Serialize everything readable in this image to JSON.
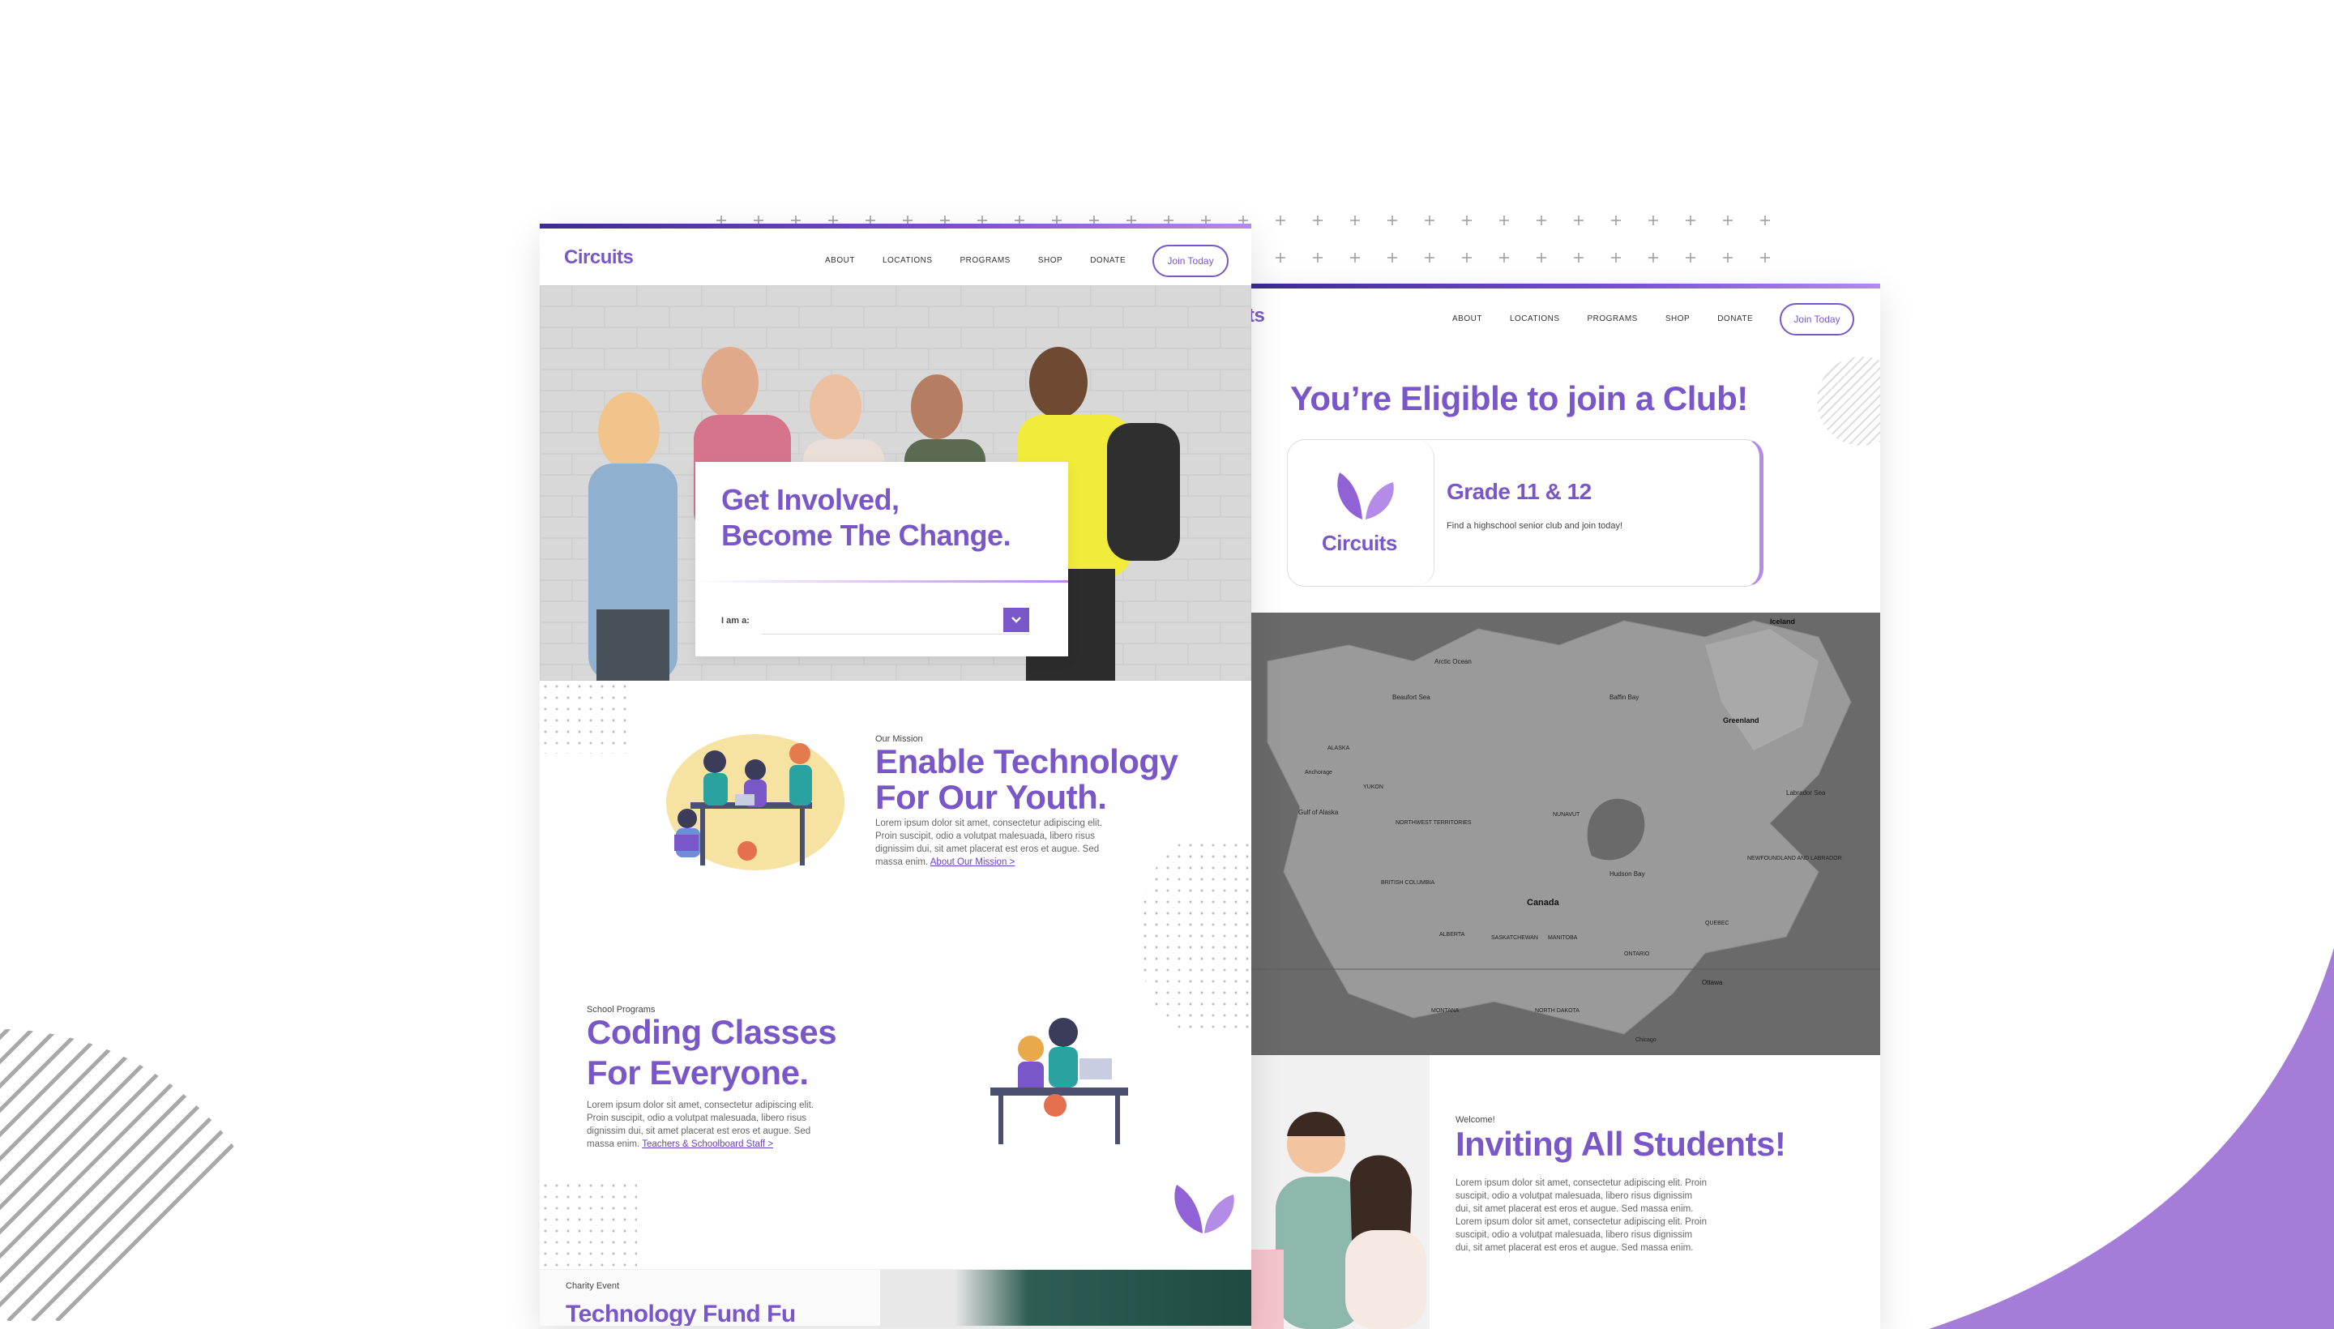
{
  "left_page": {
    "logo": "Circuits",
    "nav": [
      "ABOUT",
      "LOCATIONS",
      "PROGRAMS",
      "SHOP",
      "DONATE"
    ],
    "join_button": "Join Today",
    "hero": {
      "line1": "Get Involved,",
      "line2": "Become The Change.",
      "select_label": "I am a:",
      "select_value": ""
    },
    "mission": {
      "eyebrow": "Our Mission",
      "title_line1": "Enable Technology",
      "title_line2": "For Our Youth.",
      "body": "Lorem ipsum dolor sit amet, consectetur adipiscing elit. Proin suscipit, odio a volutpat malesuada, libero risus dignissim dui, sit amet placerat est eros et augue. Sed massa enim.",
      "link": "About Our Mission >"
    },
    "programs": {
      "eyebrow": "School Programs",
      "title_line1": "Coding Classes",
      "title_line2": "For Everyone.",
      "body": "Lorem ipsum dolor sit amet, consectetur adipiscing elit. Proin suscipit, odio a volutpat malesuada, libero risus dignissim dui, sit amet placerat est eros et augue. Sed massa enim.",
      "link": "Teachers & Schoolboard Staff >"
    },
    "charity": {
      "eyebrow": "Charity Event",
      "title": "Technology Fund Fu"
    }
  },
  "right_page": {
    "logo_fragment": "ts",
    "nav": [
      "ABOUT",
      "LOCATIONS",
      "PROGRAMS",
      "SHOP",
      "DONATE"
    ],
    "join_button": "Join Today",
    "eligible_title": "You’re Eligible to join a Club!",
    "card": {
      "logo": "Circuits",
      "title": "Grade 11 & 12",
      "text": "Find a highschool senior club and join today!"
    },
    "map": {
      "labels": {
        "canada": "Canada",
        "greenland": "Greenland",
        "iceland": "Iceland",
        "hudson_bay": "Hudson Bay",
        "baffin_bay": "Baffin Bay",
        "beaufort_sea": "Beaufort Sea",
        "alaska": "ALASKA",
        "anchorage": "Anchorage",
        "gulf_of_alaska": "Gulf of Alaska",
        "arctic_ocean": "Arctic Ocean",
        "labrador_sea": "Labrador Sea",
        "ottawa": "Ottawa",
        "northwest_territories": "NORTHWEST TERRITORIES",
        "nunavut": "NUNAVUT",
        "manitoba": "MANITOBA",
        "quebec": "QUEBEC",
        "ontario": "ONTARIO",
        "saskatchewan": "SASKATCHEWAN",
        "alberta": "ALBERTA",
        "yukon": "YUKON",
        "british_columbia": "BRITISH COLUMBIA",
        "montana": "MONTANA",
        "north_dakota": "NORTH DAKOTA",
        "chicago": "Chicago",
        "newfoundland": "NEWFOUNDLAND AND LABRADOR"
      }
    },
    "welcome": {
      "eyebrow": "Welcome!",
      "title": "Inviting All Students!",
      "body": "Lorem ipsum dolor sit amet, consectetur adipiscing elit. Proin suscipit, odio a volutpat malesuada, libero risus dignissim dui, sit amet placerat est eros et augue. Sed massa enim. Lorem ipsum dolor sit amet, consectetur adipiscing elit. Proin suscipit, odio a volutpat malesuada, libero risus dignissim dui, sit amet placerat est eros et augue. Sed massa enim."
    }
  },
  "colors": {
    "brand_purple": "#7a57c9",
    "accent_gradient_start": "#3d2a8f",
    "accent_gradient_end": "#b58be8",
    "decor_arc": "#a57dd8"
  }
}
